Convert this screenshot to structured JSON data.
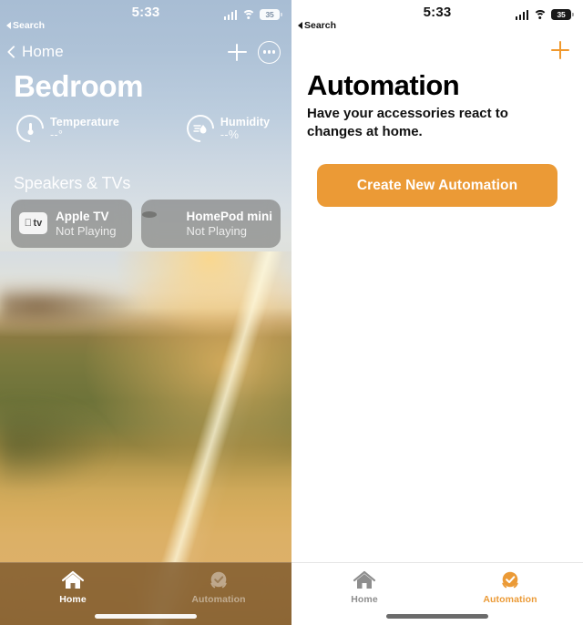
{
  "home_screen": {
    "status_bar": {
      "time": "5:33",
      "back_label": "Search",
      "back_icon": "triangle-left-icon",
      "signal_icon": "cellular-bars-icon",
      "wifi_icon": "wifi-icon",
      "battery_icon": "battery-icon",
      "battery_level": "35"
    },
    "nav": {
      "back_icon": "chevron-left-icon",
      "back_label": "Home",
      "add_icon": "plus-icon",
      "more_icon": "ellipsis-circle-icon"
    },
    "room_title": "Bedroom",
    "sensors": [
      {
        "icon": "thermometer-gauge-icon",
        "glyph": "🌡",
        "name": "Temperature",
        "value": "--°"
      },
      {
        "icon": "humidity-gauge-icon",
        "glyph": "💧",
        "name": "Humidity",
        "value": "--%"
      }
    ],
    "section_title": "Speakers & TVs",
    "tiles": [
      {
        "icon": "apple-tv-icon",
        "name": "Apple TV",
        "status": "Not Playing"
      },
      {
        "icon": "homepod-mini-icon",
        "name": "HomePod mini",
        "status": "Not Playing"
      }
    ],
    "tabs": [
      {
        "icon": "house-icon",
        "label": "Home",
        "selected": true
      },
      {
        "icon": "automation-check-icon",
        "label": "Automation",
        "selected": false
      }
    ]
  },
  "automation_screen": {
    "status_bar": {
      "time": "5:33",
      "back_label": "Search",
      "back_icon": "triangle-left-icon",
      "signal_icon": "cellular-bars-icon",
      "wifi_icon": "wifi-icon",
      "battery_icon": "battery-icon",
      "battery_level": "35"
    },
    "add_icon": "plus-icon",
    "title": "Automation",
    "subtitle": "Have your accessories react to changes at home.",
    "cta_label": "Create New Automation",
    "tabs": [
      {
        "icon": "house-icon",
        "label": "Home",
        "selected": false
      },
      {
        "icon": "automation-check-icon",
        "label": "Automation",
        "selected": true
      }
    ]
  },
  "colors": {
    "accent_orange": "#eb9a36",
    "tabbar_home_tint": "#7c582c",
    "inactive_gray": "#8e8e8e"
  }
}
